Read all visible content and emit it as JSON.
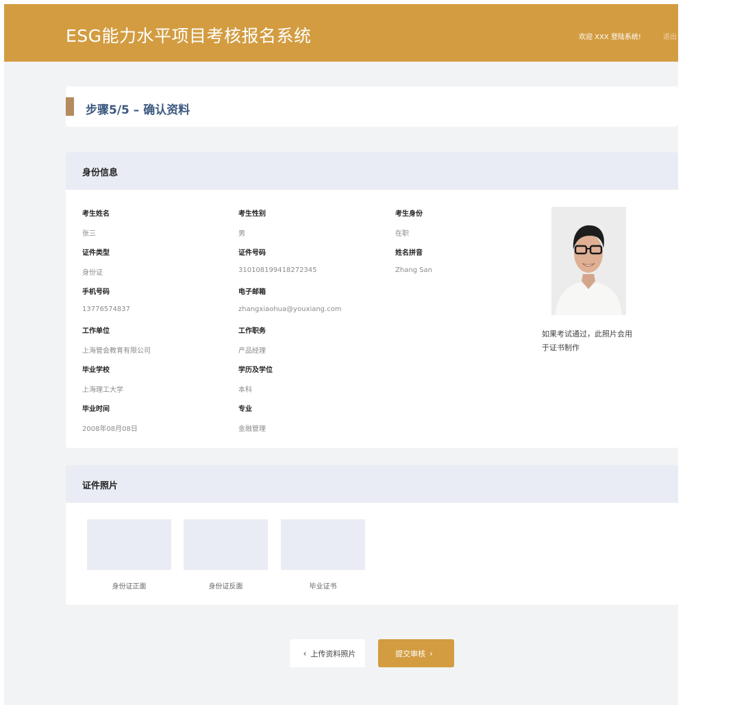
{
  "header": {
    "title": "ESG能力水平项目考核报名系统",
    "welcome": "欢迎 XXX 登陆系统!",
    "logout": "退出"
  },
  "step": {
    "title": "步骤5/5 – 确认资料"
  },
  "identity": {
    "section_title": "身份信息",
    "fields": [
      {
        "label": "考生姓名",
        "value": "张三"
      },
      {
        "label": "考生性别",
        "value": "男"
      },
      {
        "label": "考生身份",
        "value": "在职"
      },
      {
        "label": "证件类型",
        "value": "身份证"
      },
      {
        "label": "证件号码",
        "value": "310108199418272345"
      },
      {
        "label": "姓名拼音",
        "value": "Zhang San"
      },
      {
        "label": "手机号码",
        "value": "13776574837"
      },
      {
        "label": "电子邮箱",
        "value": "zhangxiaohua@youxiang.com"
      },
      {
        "label": "工作单位",
        "value": "上海管会教育有限公司"
      },
      {
        "label": "工作职务",
        "value": "产品经理"
      },
      {
        "label": "毕业学校",
        "value": "上海理工大学"
      },
      {
        "label": "学历及学位",
        "value": "本科"
      },
      {
        "label": "毕业时间",
        "value": "2008年08月08日"
      },
      {
        "label": "专业",
        "value": "金融管理"
      }
    ],
    "photo_note": "如果考试通过，此照片会用于证书制作"
  },
  "certificates": {
    "section_title": "证件照片",
    "items": [
      {
        "label": "身份证正面"
      },
      {
        "label": "身份证反面"
      },
      {
        "label": "毕业证书"
      }
    ]
  },
  "actions": {
    "back_label": "上传资料照片",
    "submit_label": "提交审核"
  },
  "colors": {
    "brand": "#d39c41",
    "step_title": "#3c587f",
    "section_bg": "#eaecf5",
    "page_bg": "#f2f3f5"
  },
  "icons": {
    "back": "chevron-left-icon",
    "submit": "chevron-right-icon"
  }
}
